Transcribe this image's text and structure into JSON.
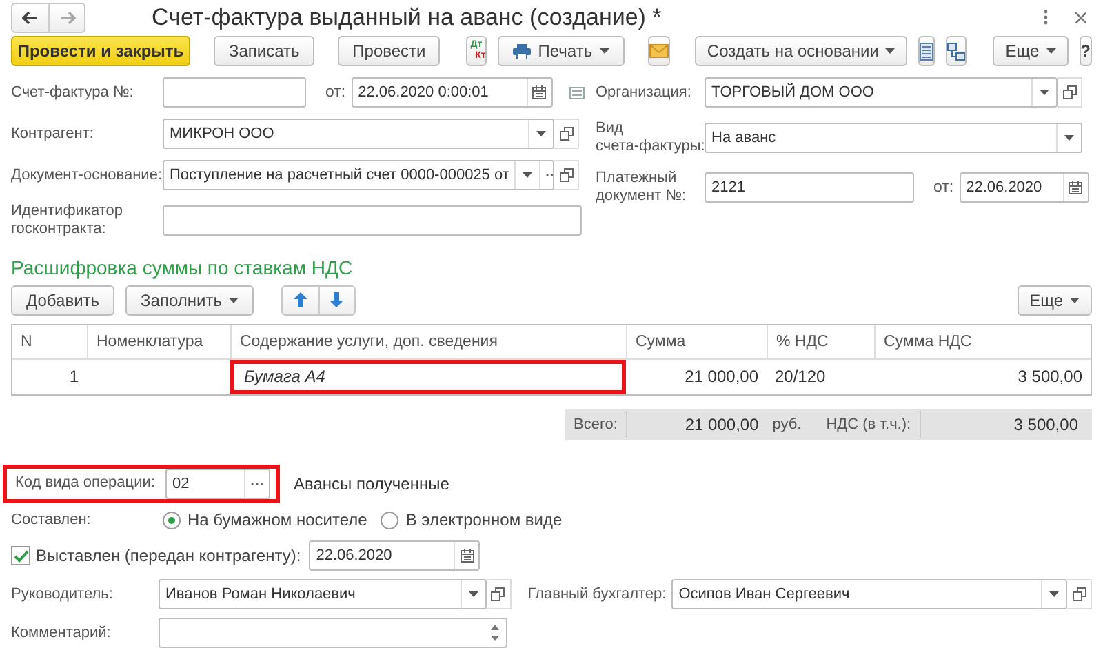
{
  "window": {
    "title": "Счет-фактура выданный на аванс (создание) *"
  },
  "toolbar": [
    {
      "kind": "primary",
      "label": "Провести и закрыть"
    },
    {
      "kind": "button",
      "label": "Записать"
    },
    {
      "kind": "button",
      "label": "Провести"
    },
    {
      "kind": "dtkt",
      "labels": [
        "Дт",
        "Кт"
      ]
    },
    {
      "kind": "print",
      "label": "Печать"
    },
    {
      "kind": "mail"
    },
    {
      "kind": "menu",
      "label": "Создать на основании"
    },
    {
      "kind": "list"
    },
    {
      "kind": "structure"
    },
    {
      "kind": "menu",
      "label": "Еще"
    },
    {
      "kind": "button",
      "label": "?"
    }
  ],
  "left_fields": [
    {
      "kind": "number_date",
      "label": "Счет-фактура №:",
      "date_label": "от:",
      "date": "22.06.2020  0:00:01"
    },
    {
      "kind": "select_open",
      "label": "Контрагент:",
      "value": "МИКРОН ООО"
    },
    {
      "kind": "select_more_open",
      "label": "Документ-основание:",
      "value": "Поступление на расчетный счет 0000-000025 от"
    },
    {
      "kind": "text",
      "label": [
        "Идентификатор",
        "госконтракта:"
      ]
    }
  ],
  "right_fields": [
    {
      "kind": "select_open",
      "label": "Организация:",
      "value": "ТОРГОВЫЙ ДОМ ООО"
    },
    {
      "kind": "select",
      "label": [
        "Вид",
        "счета-фактуры:"
      ],
      "value": "На аванс"
    },
    {
      "kind": "number_date",
      "label": [
        "Платежный",
        "документ №:"
      ],
      "value": "2121",
      "date_label": "от:",
      "date": "22.06.2020"
    }
  ],
  "section_title": "Расшифровка суммы по ставкам НДС",
  "table_toolbar": {
    "add": "Добавить",
    "fill": "Заполнить",
    "more": "Еще"
  },
  "table": {
    "columns": [
      "N",
      "Номенклатура",
      "Содержание услуги, доп. сведения",
      "Сумма",
      "% НДС",
      "Сумма НДС"
    ],
    "rows": [
      {
        "n": "1",
        "content": "Бумага А4",
        "content_highlighted": true,
        "sum": "21 000,00",
        "vat_rate": "20/120",
        "vat_sum": "3 500,00"
      }
    ]
  },
  "totals": {
    "total_label": "Всего:",
    "total": "21 000,00",
    "currency": "руб.",
    "vat_label": "НДС (в т.ч.):",
    "vat": "3 500,00"
  },
  "operation_code": {
    "label": "Код вида операции:",
    "value": "02",
    "highlighted": true,
    "description": "Авансы полученные"
  },
  "composed": {
    "label": "Составлен:",
    "options": [
      {
        "label": "На бумажном носителе",
        "selected": true
      },
      {
        "label": "В электронном виде",
        "selected": false
      }
    ]
  },
  "issued": {
    "label": "Выставлен (передан контрагенту):",
    "checked": true,
    "date": "22.06.2020"
  },
  "manager": {
    "label": "Руководитель:",
    "value": "Иванов Роман Николаевич"
  },
  "accountant": {
    "label": "Главный бухгалтер:",
    "value": "Осипов Иван Сергеевич"
  },
  "comment": {
    "label": "Комментарий:"
  }
}
